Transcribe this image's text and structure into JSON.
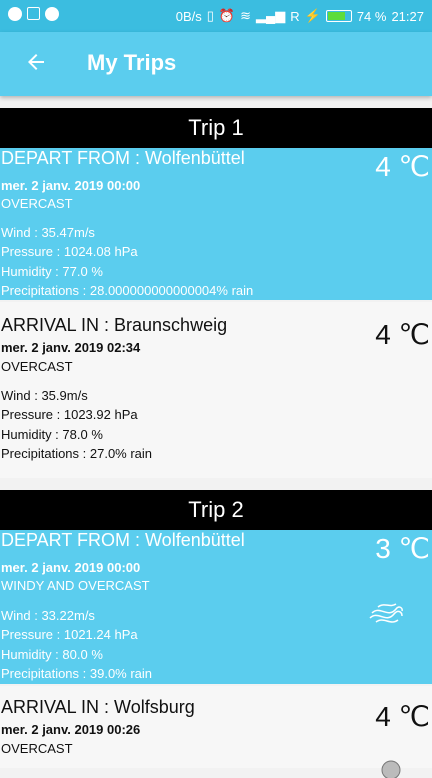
{
  "status_bar": {
    "speed": "0B/s",
    "signal_r": "R",
    "battery": "74 %",
    "time": "21:27"
  },
  "app_bar": {
    "title": "My Trips"
  },
  "trips": [
    {
      "header": "Trip 1",
      "depart": {
        "place": "DEPART FROM : Wolfenbüttel",
        "date": "mer. 2 janv. 2019 00:00",
        "condition": "OVERCAST",
        "temp": "4 ℃",
        "wind": "Wind : 35.47m/s",
        "pressure": "Pressure : 1024.08 hPa",
        "humidity": "Humidity : 77.0 %",
        "precip": "Precipitations : 28.000000000000004% rain"
      },
      "arrival": {
        "place": "ARRIVAL IN : Braunschweig",
        "date": "mer. 2 janv. 2019 02:34",
        "condition": "OVERCAST",
        "temp": "4 ℃",
        "wind": "Wind : 35.9m/s",
        "pressure": "Pressure : 1023.92 hPa",
        "humidity": "Humidity : 78.0 %",
        "precip": "Precipitations : 27.0% rain"
      }
    },
    {
      "header": "Trip 2",
      "depart": {
        "place": "DEPART FROM : Wolfenbüttel",
        "date": "mer. 2 janv. 2019 00:00",
        "condition": "WINDY AND OVERCAST",
        "temp": "3 ℃",
        "wind": "Wind : 33.22m/s",
        "pressure": "Pressure : 1021.24 hPa",
        "humidity": "Humidity : 80.0 %",
        "precip": "Precipitations : 39.0% rain"
      },
      "arrival": {
        "place": "ARRIVAL IN : Wolfsburg",
        "date": "mer. 2 janv. 2019 00:26",
        "condition": "OVERCAST",
        "temp": "4 ℃"
      }
    }
  ],
  "icons": {
    "back": "arrow-left-icon",
    "wind": "wind-icon",
    "cloud": "cloud-icon"
  },
  "colors": {
    "accent": "#5bcdee",
    "status": "#3bbde0",
    "header": "#000000"
  }
}
